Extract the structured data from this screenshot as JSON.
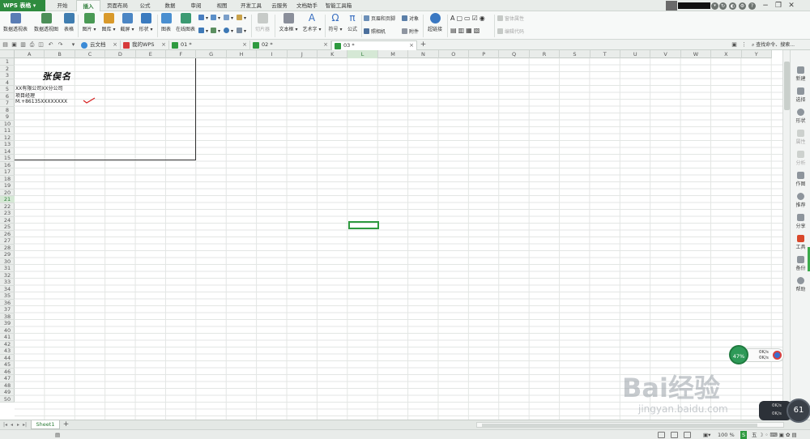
{
  "app": {
    "name": "WPS 表格"
  },
  "menu_tabs": [
    "开始",
    "插入",
    "页面布局",
    "公式",
    "数据",
    "审阅",
    "视图",
    "开发工具",
    "云服务",
    "文档助手",
    "智能工具箱"
  ],
  "active_menu": "插入",
  "ribbon": {
    "pivot_table": "数据透视表",
    "pivot_chart": "数据透视图",
    "table": "表格",
    "picture": "图片",
    "gallery": "图库",
    "screenshot": "截屏",
    "shapes": "形状",
    "chart": "图表",
    "online_chart": "在线图表",
    "slicer": "切片器",
    "textbox": "文本框",
    "wordart": "艺术字",
    "symbol": "符号",
    "formula": "公式",
    "header_footer": "页眉和页脚",
    "object": "对象",
    "camera": "照相机",
    "attachment": "附件",
    "hyperlink": "超链接",
    "form_props": "窗体属性",
    "edit_code": "编辑代码"
  },
  "doc_tabs": [
    {
      "label": "云文档"
    },
    {
      "label": "我的WPS"
    },
    {
      "label": "01 *"
    },
    {
      "label": "02 *"
    },
    {
      "label": "03 *"
    }
  ],
  "active_doc_tab": "03 *",
  "search": {
    "label": "查找命令、搜索..."
  },
  "columns": [
    "A",
    "B",
    "C",
    "D",
    "E",
    "F",
    "G",
    "H",
    "I",
    "J",
    "K",
    "L",
    "M",
    "N",
    "O",
    "P",
    "Q",
    "R",
    "S",
    "T",
    "U",
    "V",
    "W",
    "X",
    "Y"
  ],
  "selected_column": "L",
  "rows": [
    "1",
    "2",
    "3",
    "4",
    "5",
    "6",
    "7",
    "8",
    "9",
    "10",
    "11",
    "12",
    "13",
    "14",
    "15",
    "16",
    "17",
    "18",
    "19",
    "20",
    "21",
    "22",
    "23",
    "24",
    "25",
    "26",
    "27",
    "28",
    "29",
    "30",
    "31",
    "32",
    "33",
    "34",
    "35",
    "36",
    "37",
    "38",
    "39",
    "40",
    "41",
    "42",
    "43",
    "44",
    "45",
    "46",
    "47",
    "48",
    "49",
    "50"
  ],
  "selected_row": "21",
  "card": {
    "name": "张俣名",
    "company": "XX有限公司XX分公司",
    "title": "项目经理",
    "phone": "M.+86135XXXXXXXX"
  },
  "sidebar": [
    "新建",
    "选择",
    "形状",
    "属性",
    "分析",
    "作图",
    "推荐",
    "分享",
    "工具",
    "备份",
    "帮助"
  ],
  "sheet_tab": "Sheet1",
  "status": {
    "zoom": "100 %"
  },
  "net_widget": {
    "percent": "47%",
    "up": "0K/s",
    "down": "0K/s"
  },
  "cpu_widget": {
    "value": "61",
    "up": "0K/s",
    "down": "0K/s"
  },
  "watermark": {
    "brand": "Bai经验",
    "url": "jingyan.baidu.com"
  }
}
